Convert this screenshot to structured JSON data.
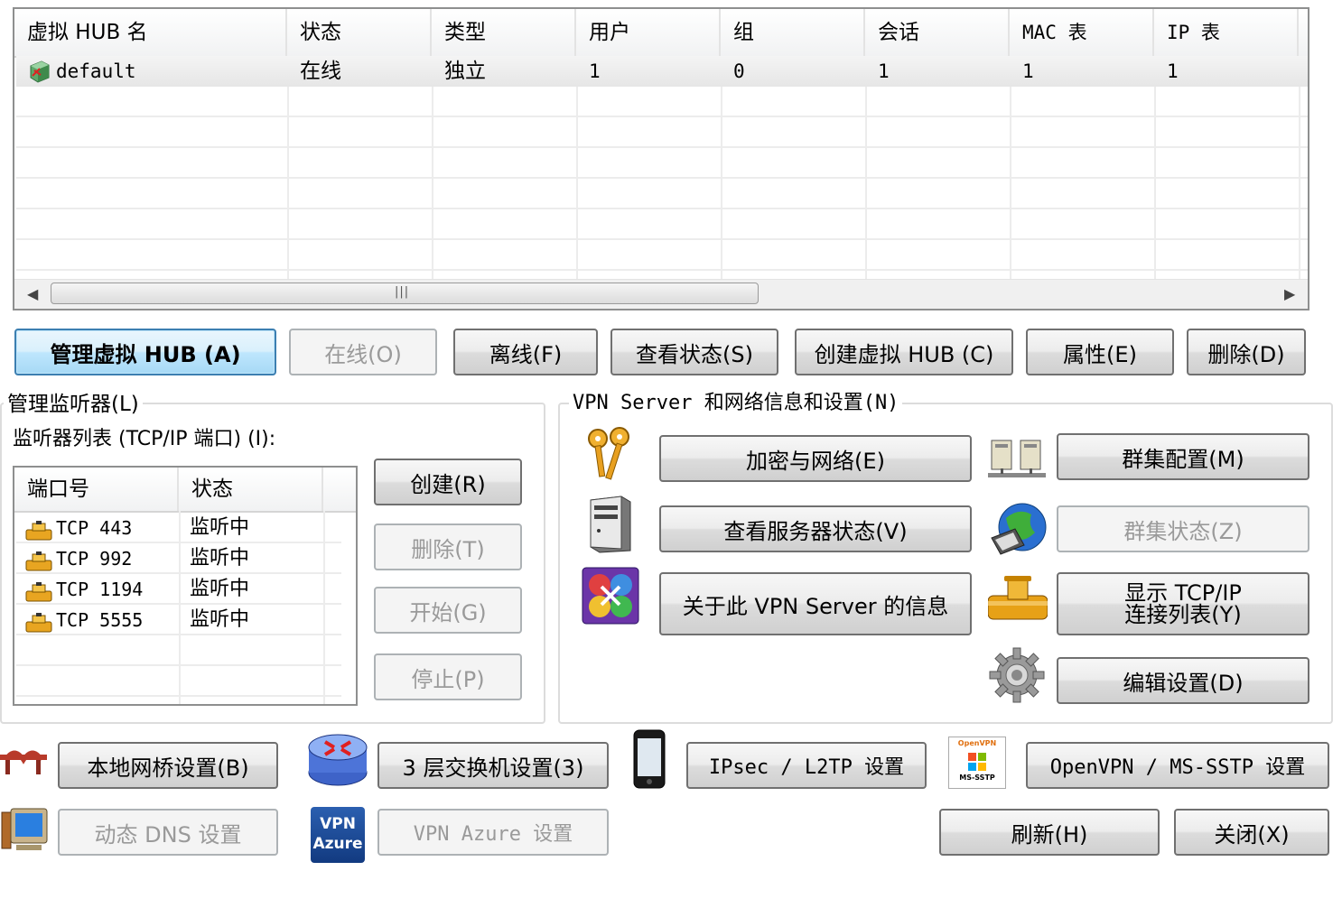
{
  "hub_list": {
    "columns": [
      "虚拟 HUB 名",
      "状态",
      "类型",
      "用户",
      "组",
      "会话",
      "MAC 表",
      "IP 表"
    ],
    "rows": [
      {
        "name": "default",
        "status": "在线",
        "type": "独立",
        "users": "1",
        "groups": "0",
        "sessions": "1",
        "mac": "1",
        "ip": "1",
        "icon": "hub-online-icon"
      }
    ]
  },
  "hub_buttons": {
    "manage": "管理虚拟 HUB (A)",
    "online": "在线(O)",
    "offline": "离线(F)",
    "status": "查看状态(S)",
    "create": "创建虚拟 HUB (C)",
    "properties": "属性(E)",
    "delete": "删除(D)"
  },
  "listeners": {
    "group_title": "管理监听器(L)",
    "list_label": "监听器列表 (TCP/IP 端口) (I):",
    "columns": [
      "端口号",
      "状态"
    ],
    "rows": [
      {
        "port": "TCP 443",
        "status": "监听中"
      },
      {
        "port": "TCP 992",
        "status": "监听中"
      },
      {
        "port": "TCP 1194",
        "status": "监听中"
      },
      {
        "port": "TCP 5555",
        "status": "监听中"
      }
    ],
    "buttons": {
      "create": "创建(R)",
      "delete": "删除(T)",
      "start": "开始(G)",
      "stop": "停止(P)"
    }
  },
  "server_info": {
    "group_title": "VPN Server 和网络信息和设置(N)",
    "encryption": "加密与网络(E)",
    "cluster_config": "群集配置(M)",
    "server_status": "查看服务器状态(V)",
    "cluster_status": "群集状态(Z)",
    "about": "关于此 VPN Server 的信息",
    "tcp_line1": "显示 TCP/IP",
    "tcp_line2": "连接列表(Y)",
    "edit_config": "编辑设置(D)"
  },
  "bottom": {
    "local_bridge": "本地网桥设置(B)",
    "l3_switch": "3 层交换机设置(3)",
    "ipsec": "IPsec / L2TP 设置",
    "openvpn": "OpenVPN / MS-SSTP 设置",
    "ddns": "动态 DNS 设置",
    "azure": "VPN Azure 设置",
    "refresh": "刷新(H)",
    "close": "关闭(X)",
    "azure_icon_line1": "VPN",
    "azure_icon_line2": "Azure",
    "openvpn_icon_top": "OpenVPN",
    "openvpn_icon_bottom": "MS-SSTP"
  },
  "colors": {
    "accent_border": "#3c7fb1",
    "disabled_text": "#9a9a9a"
  }
}
